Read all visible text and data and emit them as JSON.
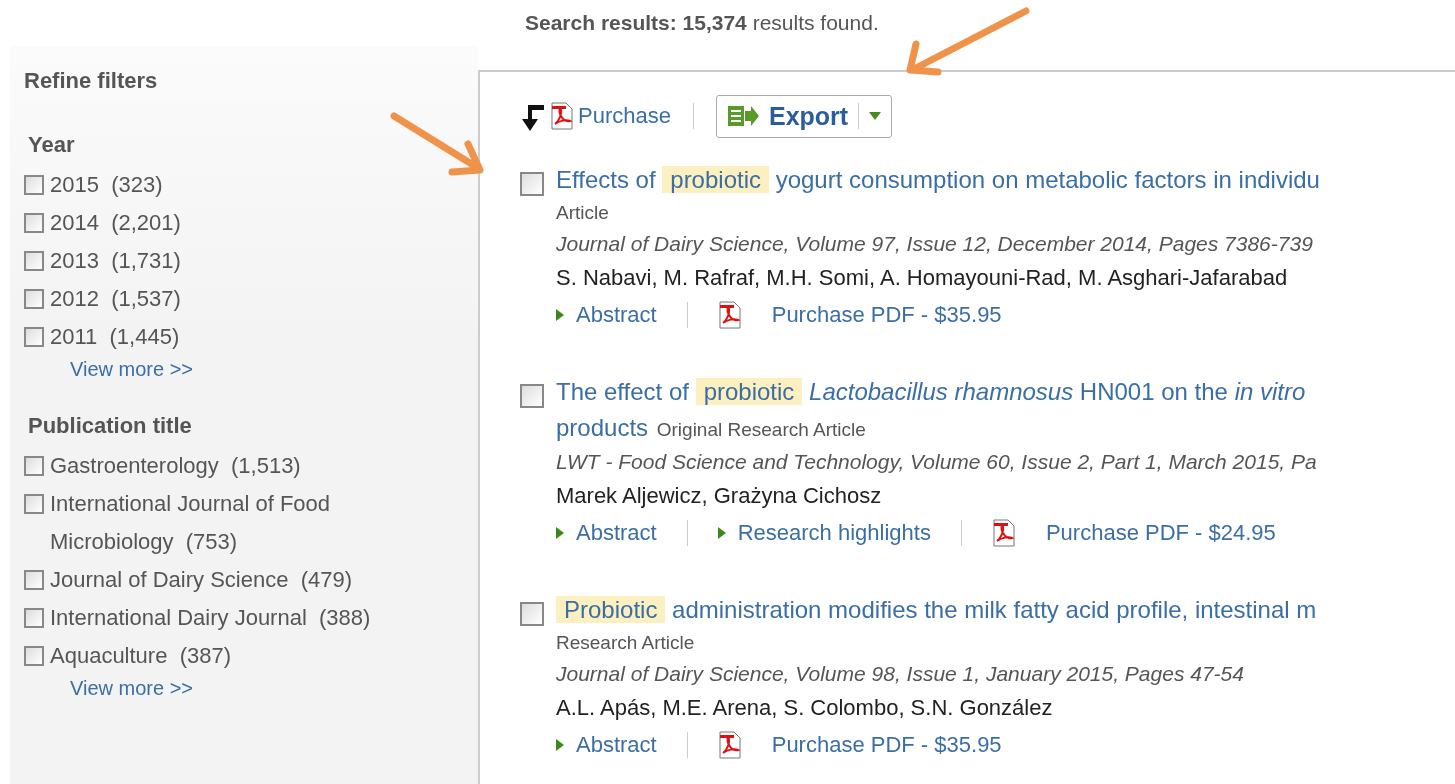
{
  "summary": {
    "label": "Search results:",
    "count": "15,374",
    "suffix": "results found."
  },
  "sidebar": {
    "title": "Refine filters",
    "groups": [
      {
        "title": "Year",
        "items": [
          {
            "label": "2015",
            "count": "(323)",
            "checked": false
          },
          {
            "label": "2014",
            "count": "(2,201)",
            "checked": false
          },
          {
            "label": "2013",
            "count": "(1,731)",
            "checked": false
          },
          {
            "label": "2012",
            "count": "(1,537)",
            "checked": false
          },
          {
            "label": "2011",
            "count": "(1,445)",
            "checked": false
          }
        ],
        "more": "View more >>"
      },
      {
        "title": "Publication title",
        "items": [
          {
            "label": "Gastroenterology",
            "count": "(1,513)",
            "checked": false
          },
          {
            "label": "International Journal of Food Microbiology",
            "count": "(753)",
            "checked": false
          },
          {
            "label": "Journal of Dairy Science",
            "count": "(479)",
            "checked": false
          },
          {
            "label": "International Dairy Journal",
            "count": "(388)",
            "checked": false
          },
          {
            "label": "Aquaculture",
            "count": "(387)",
            "checked": false
          }
        ],
        "more": "View more >>"
      }
    ]
  },
  "toolbar": {
    "purchase": "Purchase",
    "export": "Export"
  },
  "results": [
    {
      "checked": false,
      "title_lines": [
        [
          {
            "kind": "plain",
            "text": "Effects of"
          },
          {
            "kind": "highlight",
            "text": "probiotic"
          },
          {
            "kind": "plain",
            "text": "yogurt consumption on metabolic factors in individu"
          }
        ]
      ],
      "type": "Article",
      "type_inline": false,
      "source": "Journal of Dairy Science, Volume 97, Issue 12, December 2014, Pages 7386-739",
      "authors": "S. Nabavi, M. Rafraf, M.H. Somi, A. Homayouni-Rad, M. Asghari-Jafarabad",
      "actions": [
        {
          "kind": "expand",
          "label": "Abstract"
        },
        {
          "kind": "pdf",
          "label": "Purchase PDF - $35.95"
        }
      ]
    },
    {
      "checked": false,
      "title_lines": [
        [
          {
            "kind": "plain",
            "text": "The effect of"
          },
          {
            "kind": "highlight",
            "text": "probiotic"
          },
          {
            "kind": "italic",
            "text": "Lactobacillus rhamnosus"
          },
          {
            "kind": "plain",
            "text": "HN001 on the"
          },
          {
            "kind": "italic",
            "text": "in vitro"
          }
        ],
        [
          {
            "kind": "plain",
            "text": "products"
          }
        ]
      ],
      "type": "Original Research Article",
      "type_inline": true,
      "source": "LWT - Food Science and Technology, Volume 60, Issue 2, Part 1, March 2015, Pa",
      "authors": "Marek Aljewicz, Grażyna Cichosz",
      "actions": [
        {
          "kind": "expand",
          "label": "Abstract"
        },
        {
          "kind": "expand",
          "label": "Research highlights"
        },
        {
          "kind": "pdf",
          "label": "Purchase PDF - $24.95"
        }
      ]
    },
    {
      "checked": false,
      "title_lines": [
        [
          {
            "kind": "highlight",
            "text": "Probiotic"
          },
          {
            "kind": "plain",
            "text": "administration modifies the milk fatty acid profile, intestinal m"
          }
        ]
      ],
      "type": "Research Article",
      "type_inline": false,
      "source": "Journal of Dairy Science, Volume 98, Issue 1, January 2015, Pages 47-54",
      "authors": "A.L. Apás, M.E. Arena, S. Colombo, S.N. González",
      "actions": [
        {
          "kind": "expand",
          "label": "Abstract"
        },
        {
          "kind": "pdf",
          "label": "Purchase PDF - $35.95"
        }
      ]
    }
  ]
}
